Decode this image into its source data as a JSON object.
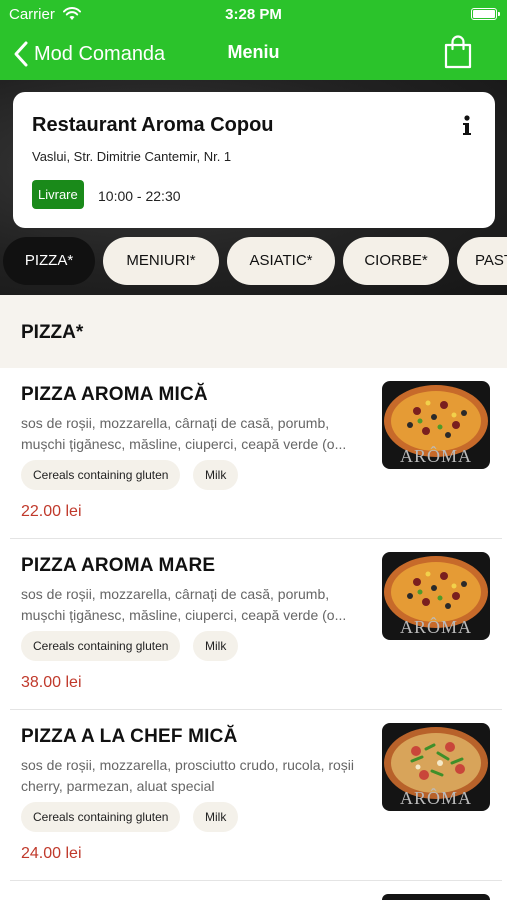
{
  "status_bar": {
    "carrier": "Carrier",
    "time": "3:28 PM"
  },
  "nav": {
    "back_label": "Mod Comanda",
    "title": "Meniu"
  },
  "restaurant": {
    "name": "Restaurant Aroma Copou",
    "address": "Vaslui, Str. Dimitrie Cantemir, Nr. 1",
    "delivery_badge": "Livrare",
    "hours": "10:00 - 22:30"
  },
  "categories": [
    {
      "label": "PIZZA*",
      "active": true
    },
    {
      "label": "MENIURI*",
      "active": false
    },
    {
      "label": "ASIATIC*",
      "active": false
    },
    {
      "label": "CIORBE*",
      "active": false
    },
    {
      "label": "PAST",
      "active": false
    }
  ],
  "section_title": "PIZZA*",
  "items": [
    {
      "name": "PIZZA AROMA MICĂ",
      "description": "sos de roșii, mozzarella, cârnați de casă, porumb, mușchi țigănesc, măsline, ciuperci, ceapă verde (o...",
      "tags": [
        "Cereals containing gluten",
        "Milk"
      ],
      "price": "22.00 lei",
      "thumb_logo": "ARÔMA"
    },
    {
      "name": "PIZZA AROMA MARE",
      "description": "sos de roșii, mozzarella, cârnați de casă, porumb, mușchi țigănesc, măsline, ciuperci, ceapă verde (o...",
      "tags": [
        "Cereals containing gluten",
        "Milk"
      ],
      "price": "38.00 lei",
      "thumb_logo": "ARÔMA"
    },
    {
      "name": "PIZZA A LA CHEF MICĂ",
      "description": "sos de roșii, mozzarella, prosciutto crudo, rucola, roșii cherry, parmezan, aluat special",
      "tags": [
        "Cereals containing gluten",
        "Milk"
      ],
      "price": "24.00 lei",
      "thumb_logo": "ARÔMA"
    }
  ],
  "colors": {
    "brand_green": "#2bc32b",
    "badge_green": "#1a8a1a",
    "price_red": "#c0392b"
  },
  "icons": [
    "wifi-icon",
    "battery-icon",
    "chevron-left-icon",
    "shopping-bag-icon",
    "info-icon",
    "pizza-image"
  ]
}
